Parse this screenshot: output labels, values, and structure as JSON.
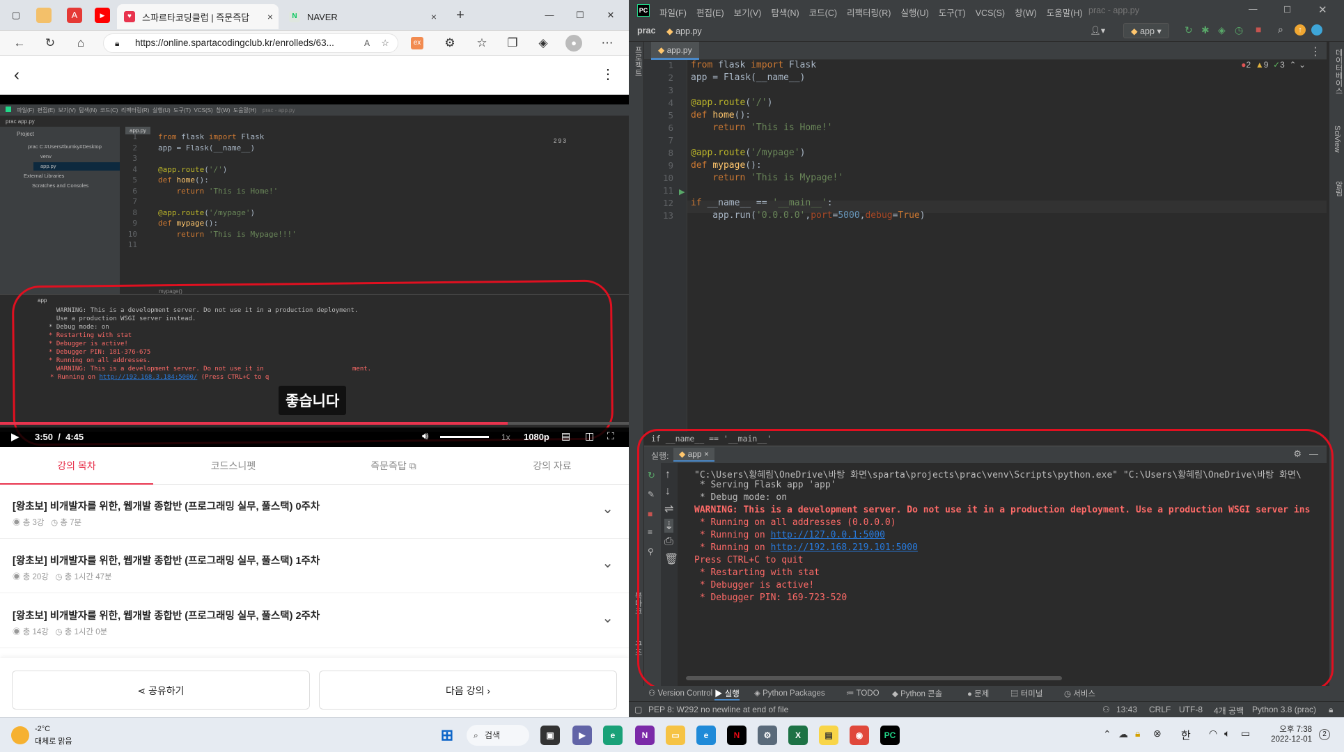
{
  "browser": {
    "tabs": [
      {
        "label": "스파르타코딩클럽 | 즉문즉답",
        "close": "×"
      },
      {
        "label": "NAVER",
        "close": "×"
      }
    ],
    "new_tab": "+",
    "window_controls": [
      "—",
      "☐",
      "✕"
    ],
    "url": "https://online.spartacodingclub.kr/enrolleds/63...",
    "toolbar_badge": "ex"
  },
  "video": {
    "ide_title": "prac - app.py",
    "ide_menu": [
      "파일(F)",
      "편집(E)",
      "보기(V)",
      "탐색(N)",
      "코드(C)",
      "리팩터링(R)",
      "실행(U)",
      "도구(T)",
      "VCS(S)",
      "창(W)",
      "도움말(H)"
    ],
    "ide_breadcrumb": "prac  app.py",
    "project_label": "Project",
    "project_tree": [
      "prac  C:#Users#bumky#Desktop",
      "venv",
      "app.py",
      "External Libraries",
      "Scratches and Consoles"
    ],
    "editor_tab": "app.py",
    "code_lines": [
      {
        "n": "1",
        "t": "from flask import Flask"
      },
      {
        "n": "2",
        "t": "app = Flask(__name__)"
      },
      {
        "n": "3",
        "t": ""
      },
      {
        "n": "4",
        "t": "@app.route('/')"
      },
      {
        "n": "5",
        "t": "def home():"
      },
      {
        "n": "6",
        "t": "    return 'This is Home!'"
      },
      {
        "n": "7",
        "t": ""
      },
      {
        "n": "8",
        "t": "@app.route('/mypage')"
      },
      {
        "n": "9",
        "t": "def mypage():"
      },
      {
        "n": "10",
        "t": "    return 'This is Mypage!!!'"
      },
      {
        "n": "11",
        "t": ""
      }
    ],
    "inspections": "2  9  3",
    "breadcrumb_fn": "mypage()",
    "run_label": "app",
    "run_lines": [
      {
        "t": "  WARNING: This is a development server. Do not use it in a production deployment.",
        "c": "w"
      },
      {
        "t": "  Use a production WSGI server instead.",
        "c": "w"
      },
      {
        "t": "* Debug mode: on",
        "c": "w"
      },
      {
        "t": "* Restarting with stat",
        "c": "r"
      },
      {
        "t": "* Debugger is active!",
        "c": "r"
      },
      {
        "t": "* Debugger PIN: 181-376-675",
        "c": "r"
      },
      {
        "t": "* Running on all addresses.",
        "c": "r"
      },
      {
        "t": "  WARNING: This is a development server. Do not use it in",
        "c": "r"
      }
    ],
    "run_link_line": "* Running on ",
    "run_link": "http://192.168.3.184:5000/",
    "run_link_tail": " (Press CTRL+C to q",
    "run_tail": "ment.",
    "subtitle": "좋습니다",
    "time_current": "3:50",
    "time_sep": "/",
    "time_total": "4:45",
    "speed": "1x",
    "quality": "1080p",
    "progress_percent": 80.7,
    "volume_percent": 100
  },
  "lecture_tabs": [
    "강의 목차",
    "코드스니펫",
    "즉문즉답",
    "강의 자료"
  ],
  "curriculum": [
    {
      "title": "[왕초보] 비개발자를 위한, 웹개발 종합반 (프로그래밍 실무, 풀스택) 0주차",
      "lessons": "총 3강",
      "duration": "총 7분"
    },
    {
      "title": "[왕초보] 비개발자를 위한, 웹개발 종합반 (프로그래밍 실무, 풀스택) 1주차",
      "lessons": "총 20강",
      "duration": "총 1시간 47분"
    },
    {
      "title": "[왕초보] 비개발자를 위한, 웹개발 종합반 (프로그래밍 실무, 풀스택) 2주차",
      "lessons": "총 14강",
      "duration": "총 1시간 0분"
    }
  ],
  "share_label": "공유하기",
  "next_label": "다음 강의",
  "ide": {
    "title": "prac - app.py",
    "menu": [
      "파일(F)",
      "편집(E)",
      "보기(V)",
      "탐색(N)",
      "코드(C)",
      "리팩터링(R)",
      "실행(U)",
      "도구(T)",
      "VCS(S)",
      "창(W)",
      "도움말(H)"
    ],
    "breadcrumb_project": "prac",
    "breadcrumb_file": "app.py",
    "run_config": "app",
    "editor_tab": "app.py",
    "left_tool": "프로젝트",
    "right_tools": [
      "데이터베이스",
      "SciView",
      "알림"
    ],
    "left_bottom_tools": [
      "북마크",
      "구조"
    ],
    "inspection_errors": "2",
    "inspection_warnings": "9",
    "inspection_ok": "3",
    "code_lines": [
      {
        "n": "1",
        "t": "from flask import Flask"
      },
      {
        "n": "2",
        "t": "app = Flask(__name__)"
      },
      {
        "n": "3",
        "t": ""
      },
      {
        "n": "4",
        "t": "@app.route('/')"
      },
      {
        "n": "5",
        "t": "def home():"
      },
      {
        "n": "6",
        "t": "    return 'This is Home!'"
      },
      {
        "n": "7",
        "t": ""
      },
      {
        "n": "8",
        "t": "@app.route('/mypage')"
      },
      {
        "n": "9",
        "t": "def mypage():"
      },
      {
        "n": "10",
        "t": "    return 'This is Mypage!'"
      },
      {
        "n": "11",
        "t": ""
      },
      {
        "n": "12",
        "t": "if __name__ == '__main__':"
      },
      {
        "n": "13",
        "t": "    app.run('0.0.0.0',port=5000,debug=True)"
      }
    ],
    "breadcrumb_bottom": "if __name__ == '__main__'",
    "run_title": "실행:",
    "run_tab": "app",
    "run_output": [
      {
        "t": "\"C:\\Users\\황혜림\\OneDrive\\바탕 화면\\sparta\\projects\\prac\\venv\\Scripts\\python.exe\" \"C:\\Users\\황혜림\\OneDrive\\바탕 화면\\",
        "c": "w"
      },
      {
        "t": " * Serving Flask app 'app'",
        "c": "w"
      },
      {
        "t": " * Debug mode: on",
        "c": "w"
      },
      {
        "t": "WARNING: This is a development server. Do not use it in a production deployment. Use a production WSGI server ins",
        "c": "rb"
      },
      {
        "t": " * Running on all addresses (0.0.0.0)",
        "c": "r"
      }
    ],
    "run_links": [
      {
        "pre": " * Running on ",
        "link": "http://127.0.0.1:5000"
      },
      {
        "pre": " * Running on ",
        "link": "http://192.168.219.101:5000"
      }
    ],
    "run_output_tail": [
      {
        "t": "Press CTRL+C to quit",
        "c": "r"
      },
      {
        "t": " * Restarting with stat",
        "c": "r"
      },
      {
        "t": " * Debugger is active!",
        "c": "r"
      },
      {
        "t": " * Debugger PIN: 169-723-520",
        "c": "r"
      }
    ],
    "bottom_tabs": [
      "Version Control",
      "실행",
      "Python Packages",
      "TODO",
      "Python 콘솔",
      "문제",
      "터미널",
      "서비스"
    ],
    "status_message": "PEP 8: W292 no newline at end of file",
    "status_right": [
      "13:43",
      "CRLF",
      "UTF-8",
      "4개 공백",
      "Python 3.8 (prac)"
    ]
  },
  "taskbar": {
    "weather_temp": "-2°C",
    "weather_desc": "대체로 맑음",
    "search_label": "검색",
    "ime": "한",
    "time": "오후 7:38",
    "date": "2022-12-01",
    "notification_count": "2",
    "apps": [
      "start-button",
      "search",
      "task-view",
      "teams",
      "edge-dev",
      "onenote",
      "file-explorer",
      "edge",
      "netflix",
      "settings",
      "excel",
      "sticky-notes",
      "chrome",
      "pycharm"
    ]
  },
  "colors": {
    "accent_red": "#e8344e",
    "annotation_red": "#e01020",
    "ide_bg": "#2b2b2b",
    "console_red": "#ff6b68",
    "link_blue": "#287bde"
  }
}
